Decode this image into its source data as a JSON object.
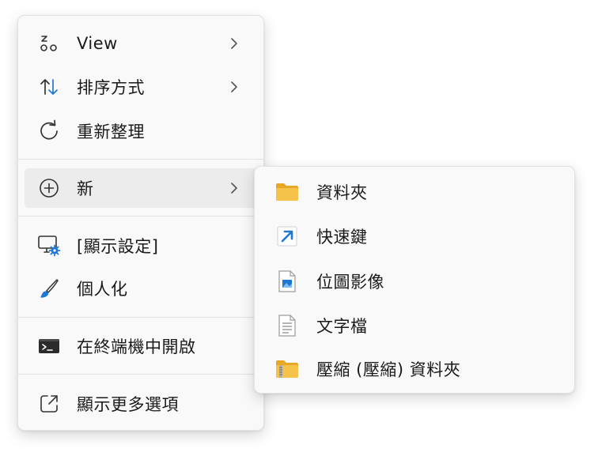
{
  "context_menu": {
    "items": [
      {
        "label": "View",
        "icon": "view-icon",
        "has_submenu": true
      },
      {
        "label": "排序方式",
        "icon": "sort-icon",
        "has_submenu": true
      },
      {
        "label": "重新整理",
        "icon": "refresh-icon",
        "has_submenu": false
      },
      {
        "label": "新",
        "icon": "new-icon",
        "has_submenu": true,
        "highlighted": true
      },
      {
        "label": "[顯示設定]",
        "icon": "display-settings-icon",
        "has_submenu": false
      },
      {
        "label": "個人化",
        "icon": "personalize-icon",
        "has_submenu": false
      },
      {
        "label": "在終端機中開啟",
        "icon": "terminal-icon",
        "has_submenu": false
      },
      {
        "label": "顯示更多選項",
        "icon": "more-options-icon",
        "has_submenu": false
      }
    ]
  },
  "new_submenu": {
    "items": [
      {
        "label": "資料夾",
        "icon": "folder-icon"
      },
      {
        "label": "快速鍵",
        "icon": "shortcut-icon"
      },
      {
        "label": "位圖影像",
        "icon": "bitmap-icon"
      },
      {
        "label": "文字檔",
        "icon": "text-file-icon"
      },
      {
        "label": "壓縮 (壓縮) 資料夾",
        "icon": "zip-folder-icon"
      }
    ]
  },
  "colors": {
    "accent": "#1e78d2",
    "folder": "#f6c34a",
    "menu_bg": "#f9f9f9",
    "highlight_bg": "#ececec",
    "separator": "#e2e2e2"
  }
}
